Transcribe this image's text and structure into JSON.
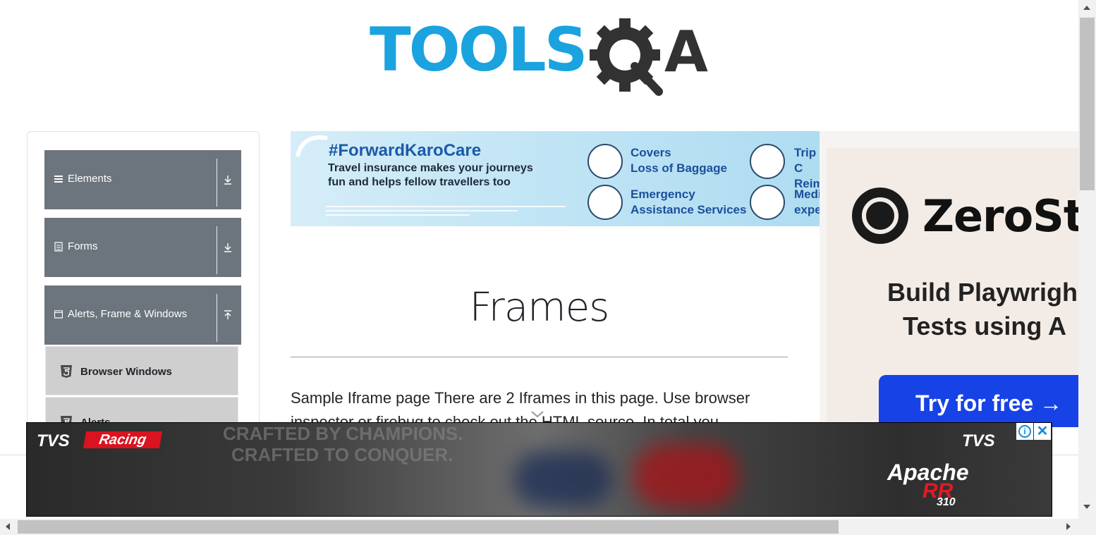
{
  "logo": {
    "text": "TOOLS",
    "suffix": "A",
    "colors": {
      "primary": "#1aa3de",
      "dark": "#323232"
    }
  },
  "sidebar": {
    "groups": [
      {
        "label": "Elements",
        "icon": "hamburger-icon",
        "arrow": "download-arrow-icon"
      },
      {
        "label": "Forms",
        "icon": "document-icon",
        "arrow": "download-arrow-icon"
      },
      {
        "label": "Alerts, Frame & Windows",
        "icon": "window-icon",
        "arrow": "upload-arrow-icon"
      }
    ],
    "items": [
      {
        "label": "Browser Windows",
        "icon": "html5-icon"
      },
      {
        "label": "Alerts",
        "icon": "html5-icon"
      }
    ]
  },
  "banner_ad": {
    "hashtag": "#ForwardKaroCare",
    "line1": "Travel insurance makes your journeys",
    "line2": "fun and helps fellow travellers too",
    "features": [
      {
        "l1": "Covers",
        "l2": "Loss of Baggage"
      },
      {
        "l1": "Trip C",
        "l2": "Reim"
      },
      {
        "l1": "Emergency",
        "l2": "Assistance Services"
      },
      {
        "l1": "Medi",
        "l2": "expe"
      }
    ]
  },
  "right_ad": {
    "brand": "ZeroSte",
    "line1": "Build Playwrigh",
    "line2": "Tests using A",
    "cta": "Try for free →",
    "cta_color": "#1742e6"
  },
  "main": {
    "title": "Frames",
    "description": "Sample Iframe page There are 2 Iframes in this page. Use browser inspector or firebug to check out the HTML source. In total you"
  },
  "bottom_ad": {
    "brand_left": "TVS",
    "racing": "Racing",
    "crafted1": "CRAFTED BY CHAMPIONS.",
    "crafted2": "CRAFTED TO CONQUER.",
    "brand_right": "TVS",
    "model": "Apache",
    "model_rr": "RR",
    "model_num": "310",
    "info_glyph": "i",
    "close_glyph": "✕"
  }
}
